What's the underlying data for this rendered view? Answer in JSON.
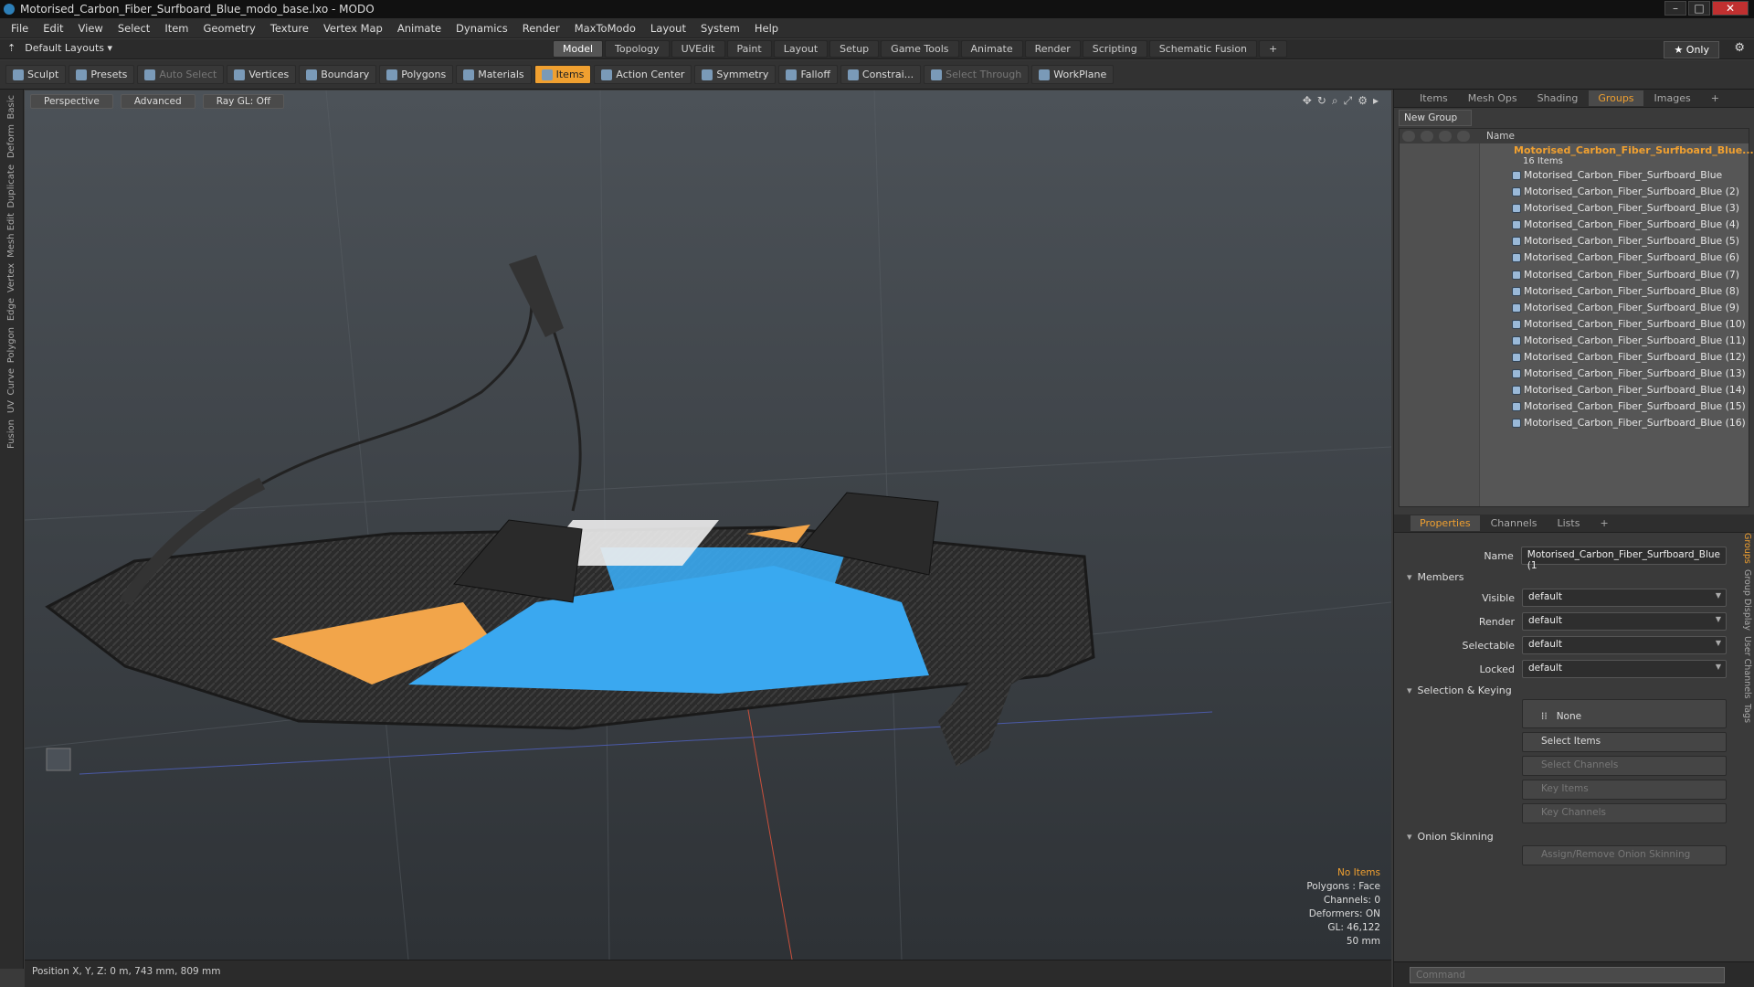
{
  "window": {
    "title": "Motorised_Carbon_Fiber_Surfboard_Blue_modo_base.lxo - MODO",
    "controls": [
      "–",
      "□",
      "✕"
    ]
  },
  "menu": [
    "File",
    "Edit",
    "View",
    "Select",
    "Item",
    "Geometry",
    "Texture",
    "Vertex Map",
    "Animate",
    "Dynamics",
    "Render",
    "MaxToModo",
    "Layout",
    "System",
    "Help"
  ],
  "layout": {
    "name": "Default Layouts ▾",
    "tabs": [
      "Model",
      "Topology",
      "UVEdit",
      "Paint",
      "Layout",
      "Setup",
      "Game Tools",
      "Animate",
      "Render",
      "Scripting",
      "Schematic Fusion"
    ],
    "active_tab": "Model",
    "add": "+",
    "only": "★ Only"
  },
  "toolbar": [
    {
      "label": "Sculpt",
      "state": "normal"
    },
    {
      "label": "Presets",
      "state": "normal"
    },
    {
      "label": "Auto Select",
      "state": "dim"
    },
    {
      "label": "Vertices",
      "state": "normal"
    },
    {
      "label": "Boundary",
      "state": "normal"
    },
    {
      "label": "Polygons",
      "state": "normal"
    },
    {
      "label": "Materials",
      "state": "normal"
    },
    {
      "label": "Items",
      "state": "active"
    },
    {
      "label": "Action Center",
      "state": "normal"
    },
    {
      "label": "Symmetry",
      "state": "normal"
    },
    {
      "label": "Falloff",
      "state": "normal"
    },
    {
      "label": "Constrai...",
      "state": "normal"
    },
    {
      "label": "Select Through",
      "state": "dim"
    },
    {
      "label": "WorkPlane",
      "state": "normal"
    }
  ],
  "sidetabs": [
    "Basic",
    "Deform",
    "Duplicate",
    "Mesh Edit",
    "Vertex",
    "Edge",
    "Polygon",
    "Curve",
    "UV",
    "Fusion"
  ],
  "viewport": {
    "buttons": [
      "Perspective",
      "Advanced",
      "Ray GL: Off"
    ],
    "hud": {
      "warn": "No Items",
      "lines": [
        "Polygons : Face",
        "Channels: 0",
        "Deformers: ON",
        "GL: 46,122",
        "50 mm"
      ]
    }
  },
  "status": "Position X, Y, Z:  0 m, 743 mm, 809 mm",
  "panel_top": {
    "tabs": [
      "Items",
      "Mesh Ops",
      "Shading",
      "Groups",
      "Images",
      "+"
    ],
    "active_tab": "Groups",
    "new_group": "New Group",
    "col_name": "Name",
    "group": {
      "name": "Motorised_Carbon_Fiber_Surfboard_Blue...",
      "count": "16 Items"
    },
    "items": [
      "Motorised_Carbon_Fiber_Surfboard_Blue",
      "Motorised_Carbon_Fiber_Surfboard_Blue (2)",
      "Motorised_Carbon_Fiber_Surfboard_Blue (3)",
      "Motorised_Carbon_Fiber_Surfboard_Blue (4)",
      "Motorised_Carbon_Fiber_Surfboard_Blue (5)",
      "Motorised_Carbon_Fiber_Surfboard_Blue (6)",
      "Motorised_Carbon_Fiber_Surfboard_Blue (7)",
      "Motorised_Carbon_Fiber_Surfboard_Blue (8)",
      "Motorised_Carbon_Fiber_Surfboard_Blue (9)",
      "Motorised_Carbon_Fiber_Surfboard_Blue (10)",
      "Motorised_Carbon_Fiber_Surfboard_Blue (11)",
      "Motorised_Carbon_Fiber_Surfboard_Blue (12)",
      "Motorised_Carbon_Fiber_Surfboard_Blue (13)",
      "Motorised_Carbon_Fiber_Surfboard_Blue (14)",
      "Motorised_Carbon_Fiber_Surfboard_Blue (15)",
      "Motorised_Carbon_Fiber_Surfboard_Blue (16)"
    ]
  },
  "panel_bottom": {
    "tabs": [
      "Properties",
      "Channels",
      "Lists",
      "+"
    ],
    "active_tab": "Properties",
    "name_label": "Name",
    "name_value": "Motorised_Carbon_Fiber_Surfboard_Blue (1",
    "members_section": "Members",
    "fields": [
      {
        "label": "Visible",
        "value": "default"
      },
      {
        "label": "Render",
        "value": "default"
      },
      {
        "label": "Selectable",
        "value": "default"
      },
      {
        "label": "Locked",
        "value": "default"
      }
    ],
    "selection_section": "Selection & Keying",
    "none_btn": "None",
    "select_items": "Select Items",
    "select_channels": "Select Channels",
    "key_items": "Key Items",
    "key_channels": "Key Channels",
    "onion_section": "Onion Skinning",
    "onion_btn": "Assign/Remove Onion Skinning",
    "side_tabs": [
      "Groups",
      "Group Display",
      "User Channels",
      "Tags"
    ]
  },
  "command_placeholder": "Command",
  "colors": {
    "accent": "#f0a030",
    "board_blue": "#3aa8f0",
    "board_orange": "#f2a54a",
    "carbon": "#2a2a2a"
  }
}
